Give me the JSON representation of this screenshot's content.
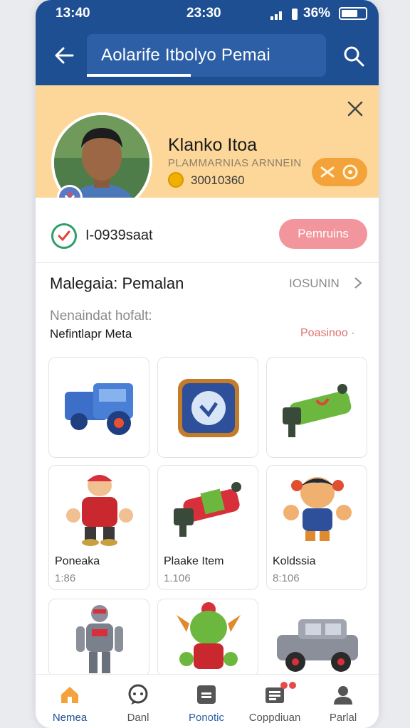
{
  "status_bar": {
    "time_left": "13:40",
    "time_center": "23:30",
    "battery_pct": "36%"
  },
  "header": {
    "title": "Aolarife Itbolyo Pemai",
    "back_icon": "arrow-left-icon",
    "search_icon": "search-icon"
  },
  "profile": {
    "name": "Klanko Itoa",
    "subtitle": "PLAMMARNIAS ARNNEIN",
    "coins": "30010360",
    "close_icon": "close-icon",
    "action_icon": "gear-icon"
  },
  "account_row": {
    "id": "I-0939saat",
    "button": "Pemruins"
  },
  "section": {
    "title": "Malegaia: Pemalan",
    "more": "IOSUNIN",
    "sub_label": "Nenaindat hofalt:",
    "sub_value": "Nefintlapr Meta",
    "link": "Poasinoo ·"
  },
  "grid": [
    {
      "icon": "blue-truck-icon",
      "name": "",
      "value": ""
    },
    {
      "icon": "shield-badge-icon",
      "name": "",
      "value": ""
    },
    {
      "icon": "green-cannon-icon",
      "name": "",
      "value": ""
    },
    {
      "icon": "red-figure-icon",
      "name": "Poneaka",
      "value": "1:86"
    },
    {
      "icon": "red-cannon-icon",
      "name": "Plaake Item",
      "value": "1.106"
    },
    {
      "icon": "hero-figure-icon",
      "name": "Koldssia",
      "value": "8:106"
    },
    {
      "icon": "armored-figure-icon",
      "name": "",
      "value": ""
    },
    {
      "icon": "green-goblin-icon",
      "name": "",
      "value": ""
    },
    {
      "icon": "gray-jeep-icon",
      "name": "",
      "value": ""
    }
  ],
  "nav": [
    {
      "label": "Nemea",
      "icon": "home-icon",
      "active": true
    },
    {
      "label": "Danl",
      "icon": "chat-icon",
      "active": false
    },
    {
      "label": "Ponotic",
      "icon": "card-icon",
      "active": false
    },
    {
      "label": "Coppdiuan",
      "icon": "inbox-icon",
      "active": false
    },
    {
      "label": "Parlal",
      "icon": "person-icon",
      "active": false
    }
  ],
  "colors": {
    "header": "#1e4f93",
    "profile_bg": "#fdd79a",
    "pill": "#f3959c",
    "accent": "#1e4f93"
  }
}
